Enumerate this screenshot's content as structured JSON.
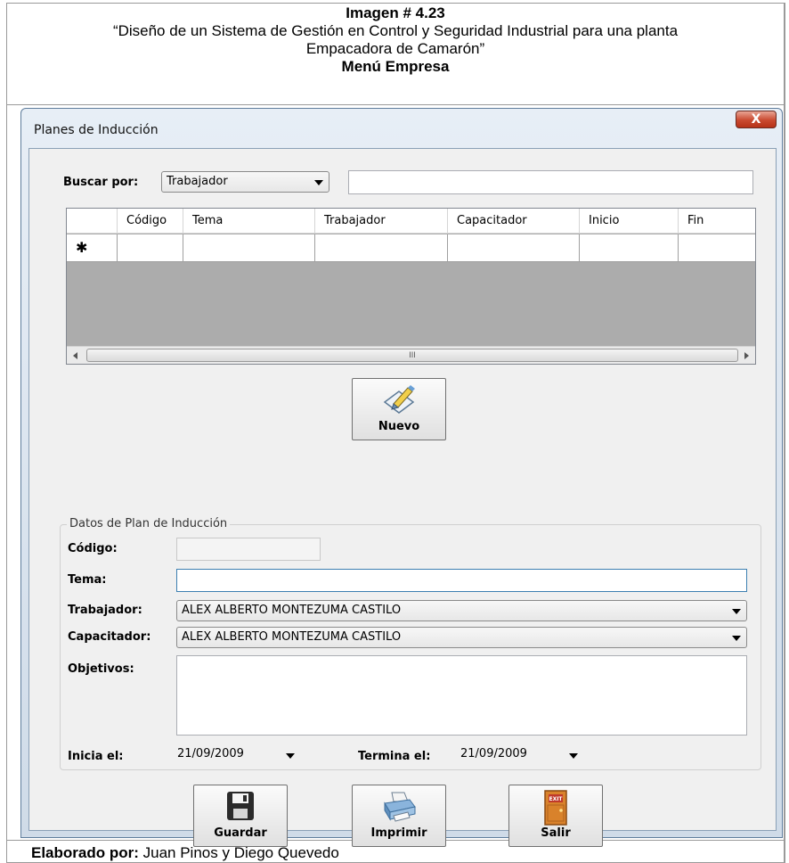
{
  "document": {
    "title": "Imagen # 4.23",
    "subtitle_line1": "“Diseño de un Sistema de Gestión en Control y Seguridad Industrial para una planta",
    "subtitle_line2": "Empacadora de Camarón”",
    "section": "Menú Empresa",
    "footer_label": "Elaborado por:",
    "footer_value": " Juan Pinos y Diego Quevedo"
  },
  "window": {
    "title": "Planes de Inducción",
    "close_glyph": "X"
  },
  "search": {
    "label": "Buscar por:",
    "selected": "Trabajador",
    "value": ""
  },
  "grid": {
    "columns": [
      "",
      "Código",
      "Tema",
      "Trabajador",
      "Capacitador",
      "Inicio",
      "Fin"
    ],
    "new_row_marker": "✱",
    "scroll_glyph": "III"
  },
  "buttons": {
    "nuevo": "Nuevo",
    "guardar": "Guardar",
    "imprimir": "Imprimir",
    "salir": "Salir",
    "exit_sign": "EXIT"
  },
  "form": {
    "group_title": "Datos de Plan de Inducción",
    "codigo_label": "Código:",
    "codigo_value": "",
    "tema_label": "Tema:",
    "tema_value": "",
    "trabajador_label": "Trabajador:",
    "trabajador_value": "ALEX ALBERTO MONTEZUMA CASTILO",
    "capacitador_label": "Capacitador:",
    "capacitador_value": "ALEX ALBERTO MONTEZUMA CASTILO",
    "objetivos_label": "Objetivos:",
    "objetivos_value": "",
    "inicia_label": "Inicia el:",
    "inicia_value": "21/09/2009",
    "termina_label": "Termina el:",
    "termina_value": "21/09/2009"
  }
}
